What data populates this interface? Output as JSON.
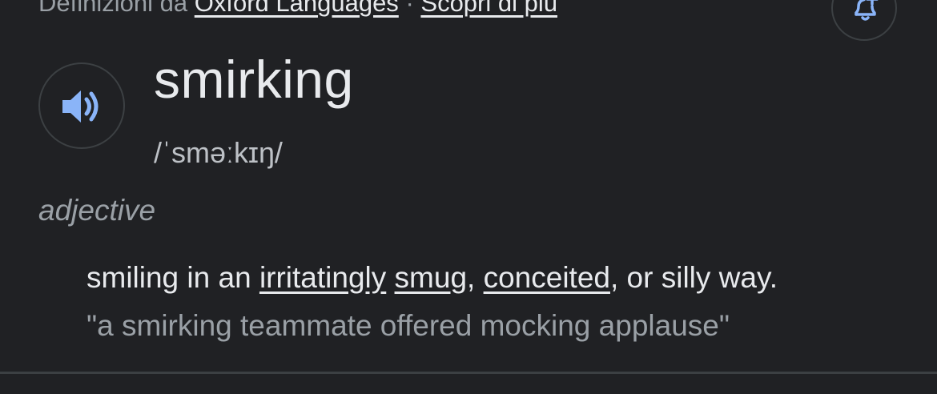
{
  "source": {
    "prefix": "Definizioni da",
    "provider_link": "Oxford Languages",
    "separator": "·",
    "more_link": "Scopri di più"
  },
  "alert_icon": "bell-plus-icon",
  "speaker_icon": "speaker-icon",
  "entry": {
    "word": "smirking",
    "phonetic": "/ˈsməːkɪŋ/",
    "part_of_speech": "adjective",
    "definition": {
      "t1": "smiling in an ",
      "link1": "irritatingly",
      "t2": " ",
      "link2": "smug",
      "t3": ", ",
      "link3": "conceited",
      "t4": ", or silly way."
    },
    "example": "\"a smirking teammate offered mocking applause\""
  },
  "colors": {
    "background": "#202124",
    "text": "#e8eaed",
    "muted": "#9aa0a6",
    "accent": "#8ab4f8",
    "border": "#3c4043"
  }
}
